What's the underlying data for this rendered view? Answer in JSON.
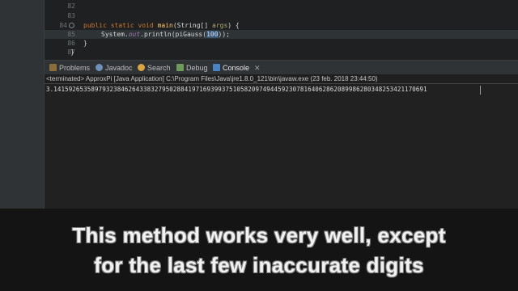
{
  "editor": {
    "lines": [
      {
        "num": "82",
        "text": ""
      },
      {
        "num": "83",
        "text": ""
      },
      {
        "num": "84",
        "text": "public static void main(String[] args) {"
      },
      {
        "num": "85",
        "text": "System.out.println(piGauss(100));"
      },
      {
        "num": "86",
        "text": "}"
      },
      {
        "num": "87",
        "text": "}"
      }
    ],
    "line84": {
      "kw1": "public",
      "kw2": "static",
      "kw3": "void",
      "method": "main",
      "params": "(String[] ",
      "arg": "args",
      "end": ") {"
    },
    "line85": {
      "prefix": "System.",
      "field": "out",
      "call": ".println(piGauss(",
      "selected": "100",
      "suffix": "));"
    },
    "line86": "}",
    "line87": "}"
  },
  "tabs": [
    {
      "label": "Problems",
      "icon": "problems-icon"
    },
    {
      "label": "Javadoc",
      "icon": "javadoc-icon"
    },
    {
      "label": "Search",
      "icon": "search-icon"
    },
    {
      "label": "Debug",
      "icon": "debug-icon"
    },
    {
      "label": "Console",
      "icon": "console-icon",
      "active": true
    }
  ],
  "console": {
    "status": "<terminated> ApproxPi [Java Application] C:\\Program Files\\Java\\jre1.8.0_121\\bin\\javaw.exe (23 feb. 2018 23:44:50)",
    "output": "3.14159265358979323846264338327950288419716939937510582097494459230781640628620899862803482534211706​91"
  },
  "subtitle": {
    "line1": "This method works very well, except",
    "line2": "for the last few inaccurate digits"
  }
}
